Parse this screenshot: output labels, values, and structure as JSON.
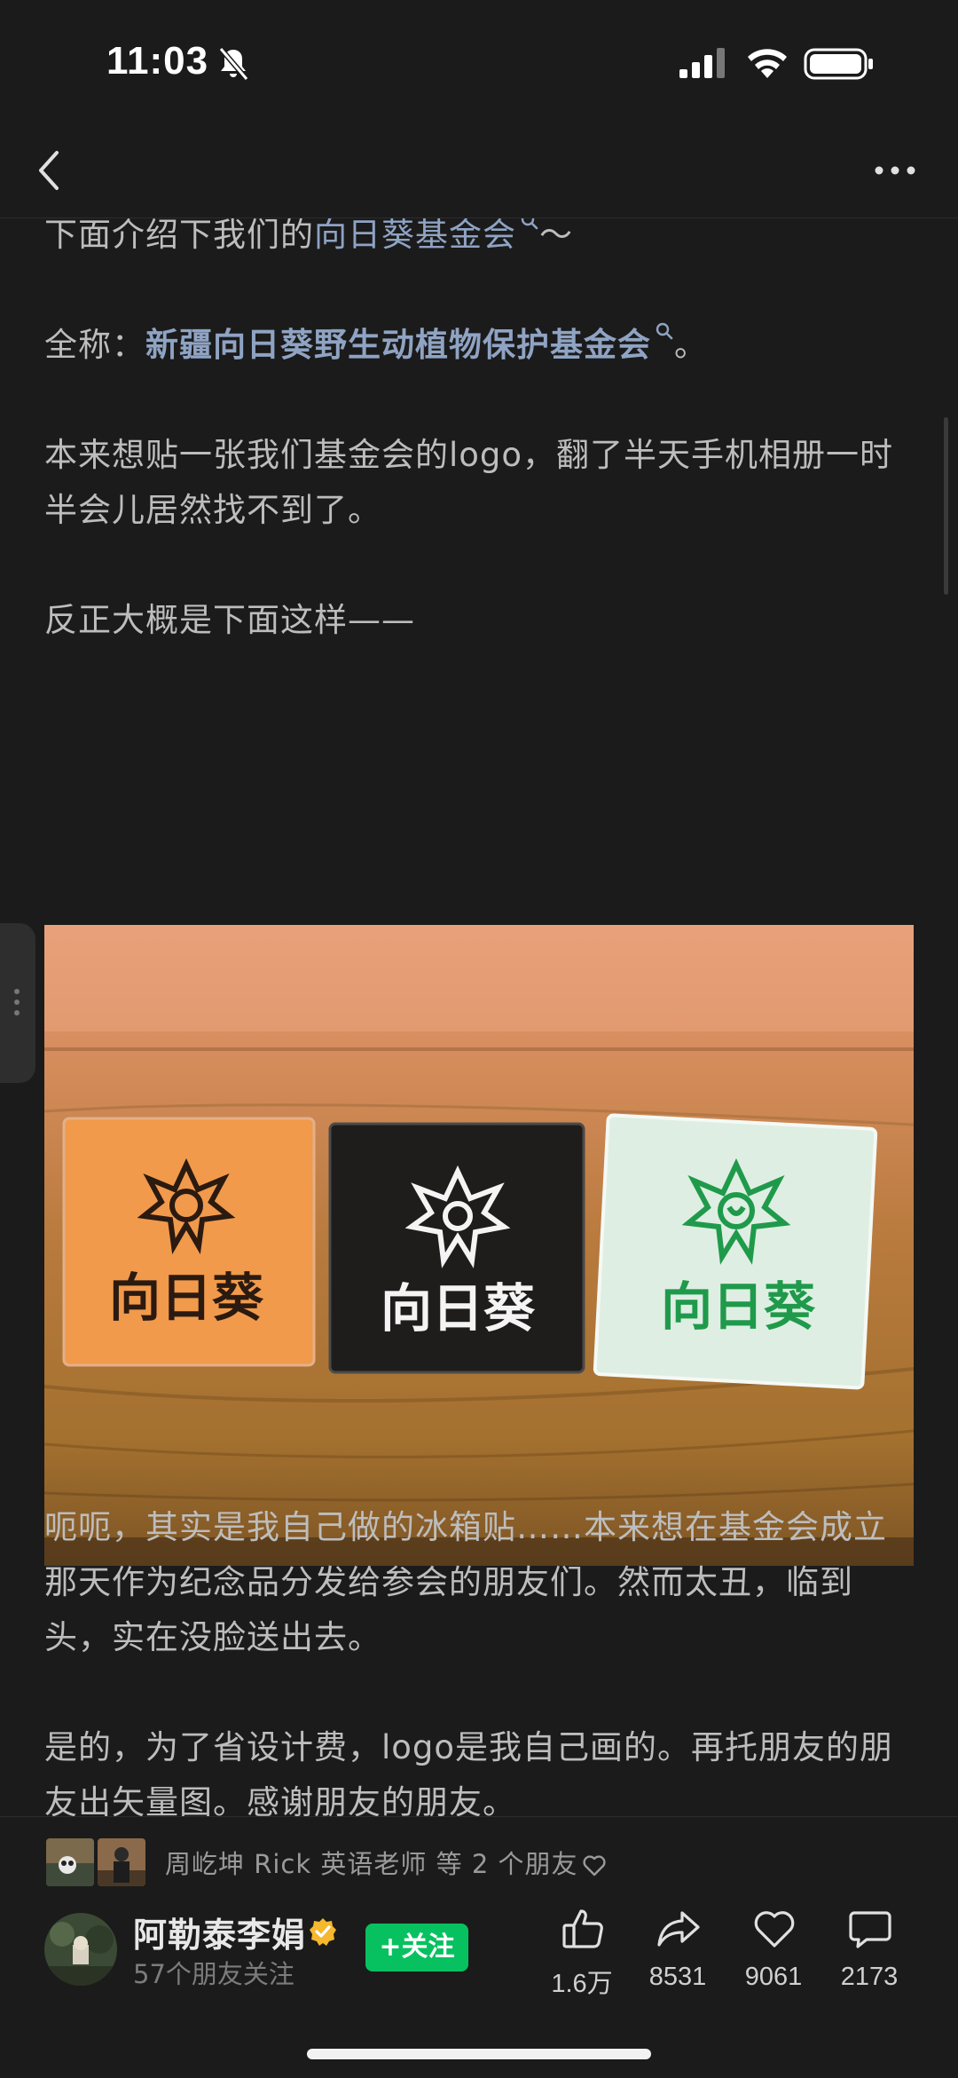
{
  "status": {
    "time": "11:03"
  },
  "article": {
    "intro_prefix": "下面介绍下我们的",
    "intro_link": "向日葵基金会",
    "intro_suffix": "～",
    "fullname_prefix": "全称：",
    "fullname_link": "新疆向日葵野生动植物保护基金会",
    "fullname_suffix": "。",
    "para1": "本来想贴一张我们基金会的logo，翻了半天手机相册一时半会儿居然找不到了。",
    "para2": "反正大概是下面这样——",
    "photo_tiles": [
      "向日葵",
      "向日葵",
      "向日葵"
    ],
    "para3": "呃呃，其实是我自己做的冰箱贴……本来想在基金会成立那天作为纪念品分发给参会的朋友们。然而太丑，临到头，实在没脸送出去。",
    "para4": "是的，为了省设计费，logo是我自己画的。再托朋友的朋友出矢量图。感谢朋友的朋友。"
  },
  "social": {
    "friends_liked": "周屹坤 Rick 英语老师 等 2 个朋友"
  },
  "author": {
    "name": "阿勒泰李娟",
    "followers": "57个朋友关注",
    "follow_label": "+关注"
  },
  "actions": {
    "like_count": "1.6万",
    "share_count": "8531",
    "favorite_count": "9061",
    "comment_count": "2173"
  },
  "colors": {
    "background": "#1b1b1b",
    "link": "#8fa3c3",
    "follow_green": "#07c160",
    "verified_gold": "#f5b82e"
  }
}
